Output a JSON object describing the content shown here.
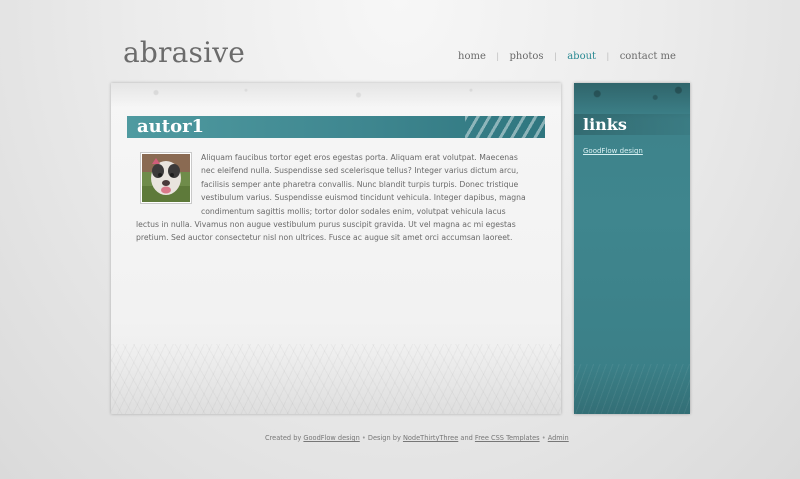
{
  "site": {
    "logo": "abrasive"
  },
  "nav": {
    "items": [
      {
        "label": "home",
        "active": false
      },
      {
        "label": "photos",
        "active": false
      },
      {
        "label": "about",
        "active": true
      },
      {
        "label": "contact me",
        "active": false
      }
    ],
    "separator": "|"
  },
  "post": {
    "title": "autor1",
    "avatar_icon": "dog-photo",
    "body": "Aliquam faucibus tortor eget eros egestas porta. Aliquam erat volutpat. Maecenas nec eleifend nulla. Suspendisse sed scelerisque tellus? Integer varius dictum arcu, facilisis semper ante pharetra convallis. Nunc blandit turpis turpis. Donec tristique vestibulum varius. Suspendisse euismod tincidunt vehicula. Integer dapibus, magna condimentum sagittis mollis; tortor dolor sodales enim, volutpat vehicula lacus lectus in nulla. Vivamus non augue vestibulum purus suscipit gravida. Ut vel magna ac mi egestas pretium. Sed auctor consectetur nisl non ultrices. Fusce ac augue sit amet orci accumsan laoreet."
  },
  "sidebar": {
    "title": "links",
    "links": [
      {
        "label": "GoodFlow design"
      }
    ]
  },
  "footer": {
    "created_by_text": "Created by",
    "created_by_link": "GoodFlow design",
    "bullet": "•",
    "design_by_text": "Design by",
    "design_by_link": "NodeThirtyThree",
    "and_text": "and",
    "templates_link": "Free CSS Templates",
    "admin_link": "Admin"
  },
  "colors": {
    "accent": "#2b8a93",
    "teal_panel": "#3d8189",
    "background": "#e6e6e6"
  }
}
